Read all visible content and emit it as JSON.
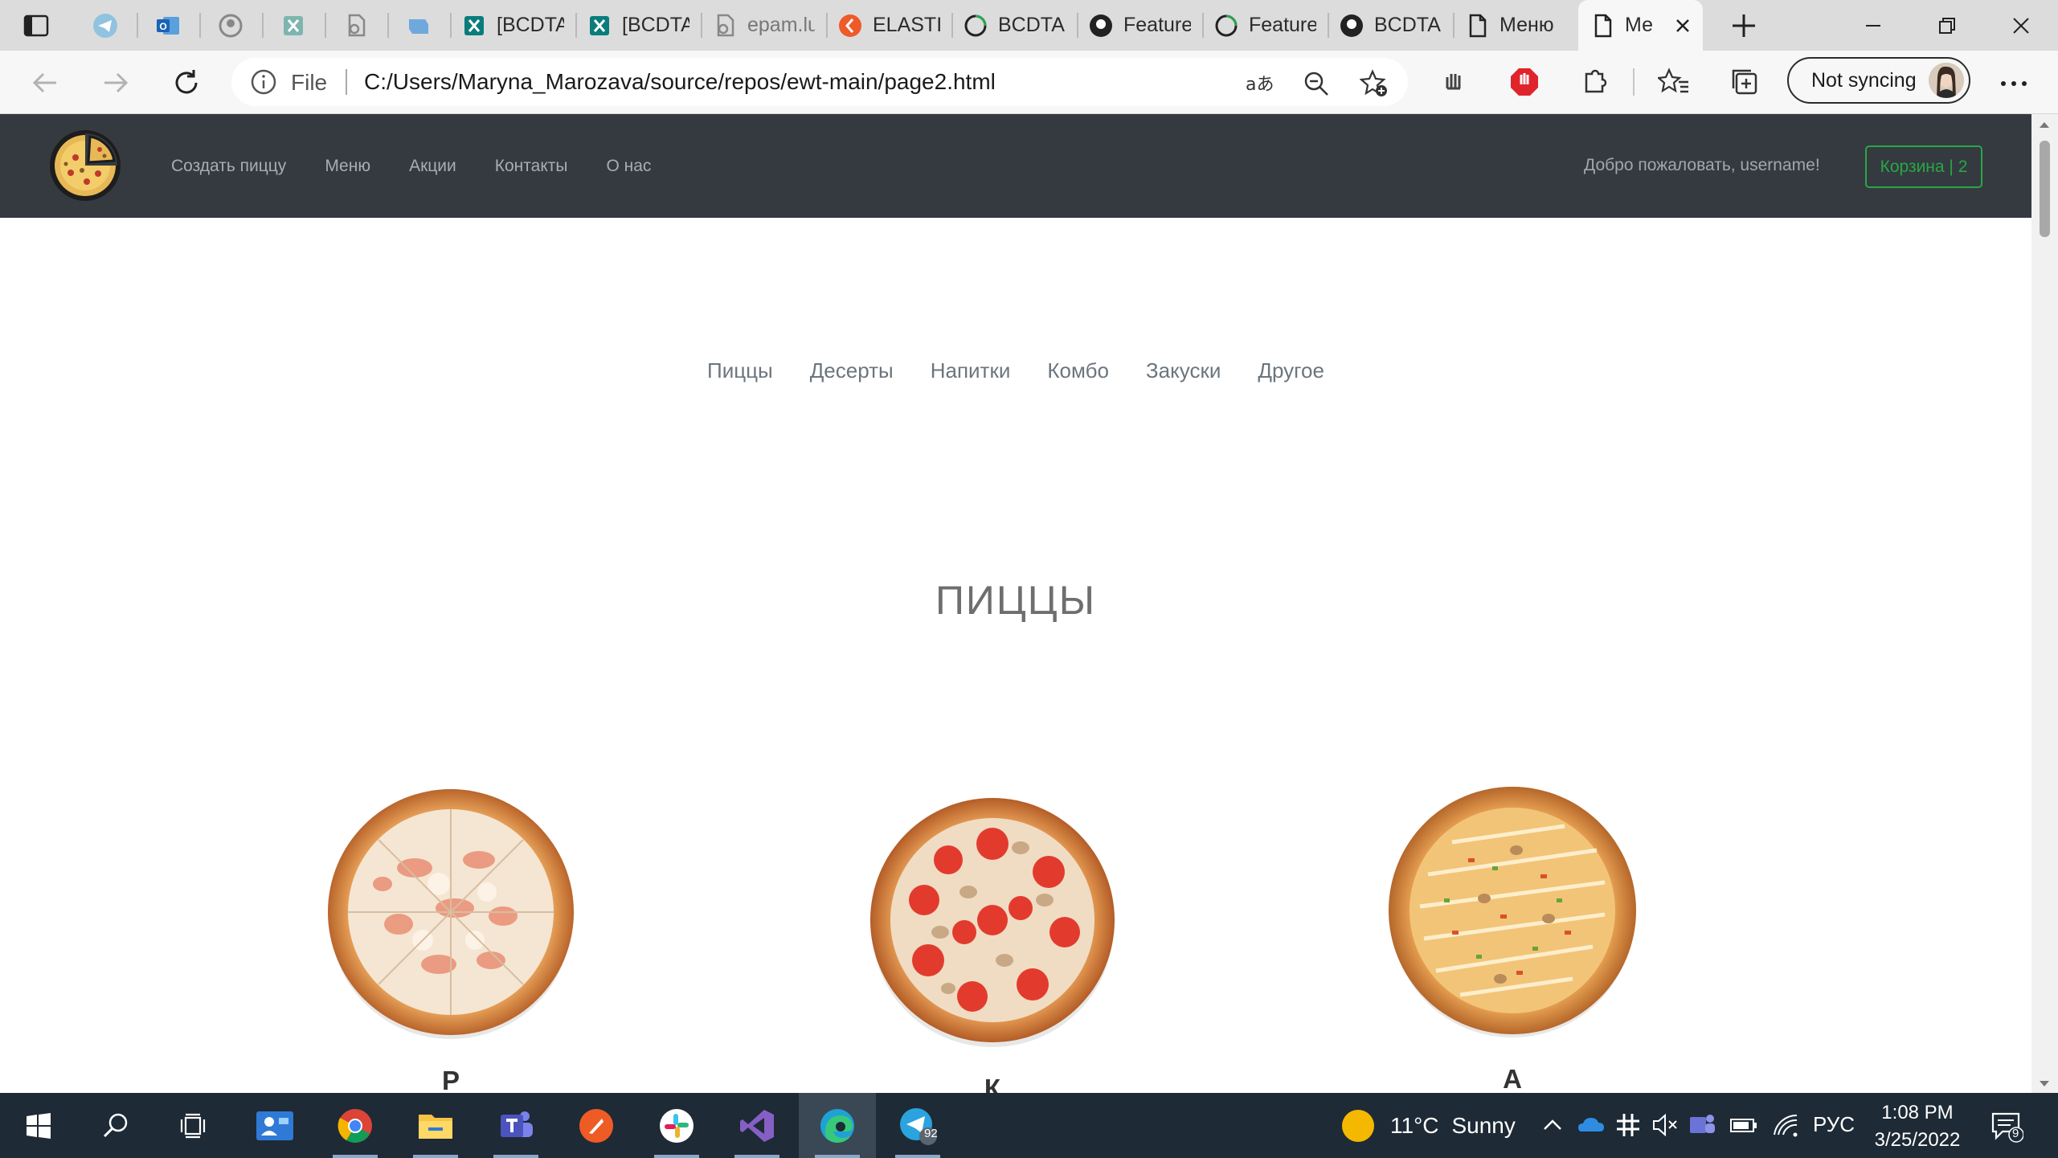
{
  "browser": {
    "tabs": [
      {
        "type": "pinned",
        "icon": "telegram-icon"
      },
      {
        "type": "pinned",
        "icon": "outlook-icon"
      },
      {
        "type": "pinned",
        "icon": "github-icon"
      },
      {
        "type": "pinned",
        "icon": "jira-icon"
      },
      {
        "type": "pinned",
        "icon": "document-link-icon"
      },
      {
        "type": "pinned",
        "icon": "app-icon"
      },
      {
        "type": "regular",
        "icon": "jira-icon",
        "title": "[BCDTA"
      },
      {
        "type": "regular",
        "icon": "jira-icon",
        "title": "[BCDTA"
      },
      {
        "type": "regular",
        "icon": "document-link-icon",
        "title": "epam.lu"
      },
      {
        "type": "regular",
        "icon": "elastic-icon",
        "title": "ELASTIC"
      },
      {
        "type": "regular",
        "icon": "github-pr-icon",
        "title": "BCDTAP"
      },
      {
        "type": "regular",
        "icon": "github-icon",
        "title": "Feature"
      },
      {
        "type": "regular",
        "icon": "github-pr-icon",
        "title": "Feature"
      },
      {
        "type": "regular",
        "icon": "github-icon",
        "title": "BCDTAP"
      },
      {
        "type": "regular",
        "icon": "file-icon",
        "title": "Меню"
      },
      {
        "type": "active",
        "icon": "file-icon",
        "title": "Ме"
      }
    ],
    "address": {
      "scheme": "File",
      "url": "C:/Users/Maryna_Marozava/source/repos/ewt-main/page2.html"
    },
    "sync_label": "Not syncing"
  },
  "site": {
    "nav_links": [
      "Создать пиццу",
      "Меню",
      "Акции",
      "Контакты",
      "О нас"
    ],
    "welcome": "Добро пожаловать, username!",
    "cart_label": "Корзина | 2",
    "categories": [
      "Пиццы",
      "Десерты",
      "Напитки",
      "Комбо",
      "Закуски",
      "Другое"
    ],
    "section_heading": "ПИЦЦЫ",
    "products": [
      {
        "name": "Р",
        "style": "ham-cheese"
      },
      {
        "name": "К",
        "style": "tomato-mushroom"
      },
      {
        "name": "А",
        "style": "veggie-sauce"
      }
    ],
    "colors": {
      "navbar": "#343a40",
      "cart_accent": "#28a745",
      "muted_text": "#6c757d"
    }
  },
  "taskbar": {
    "apps": [
      "start-icon",
      "search-icon",
      "task-view-icon",
      "people-app-icon",
      "chrome-icon",
      "file-explorer-icon",
      "teams-icon",
      "postman-icon",
      "slack-icon",
      "visual-studio-icon",
      "edge-icon",
      "telegram-icon"
    ],
    "telegram_badge": "92",
    "weather": {
      "temp": "11°C",
      "condition": "Sunny"
    },
    "language": "РУС",
    "time": "1:08 PM",
    "date": "3/25/2022",
    "notification_count": "9"
  }
}
